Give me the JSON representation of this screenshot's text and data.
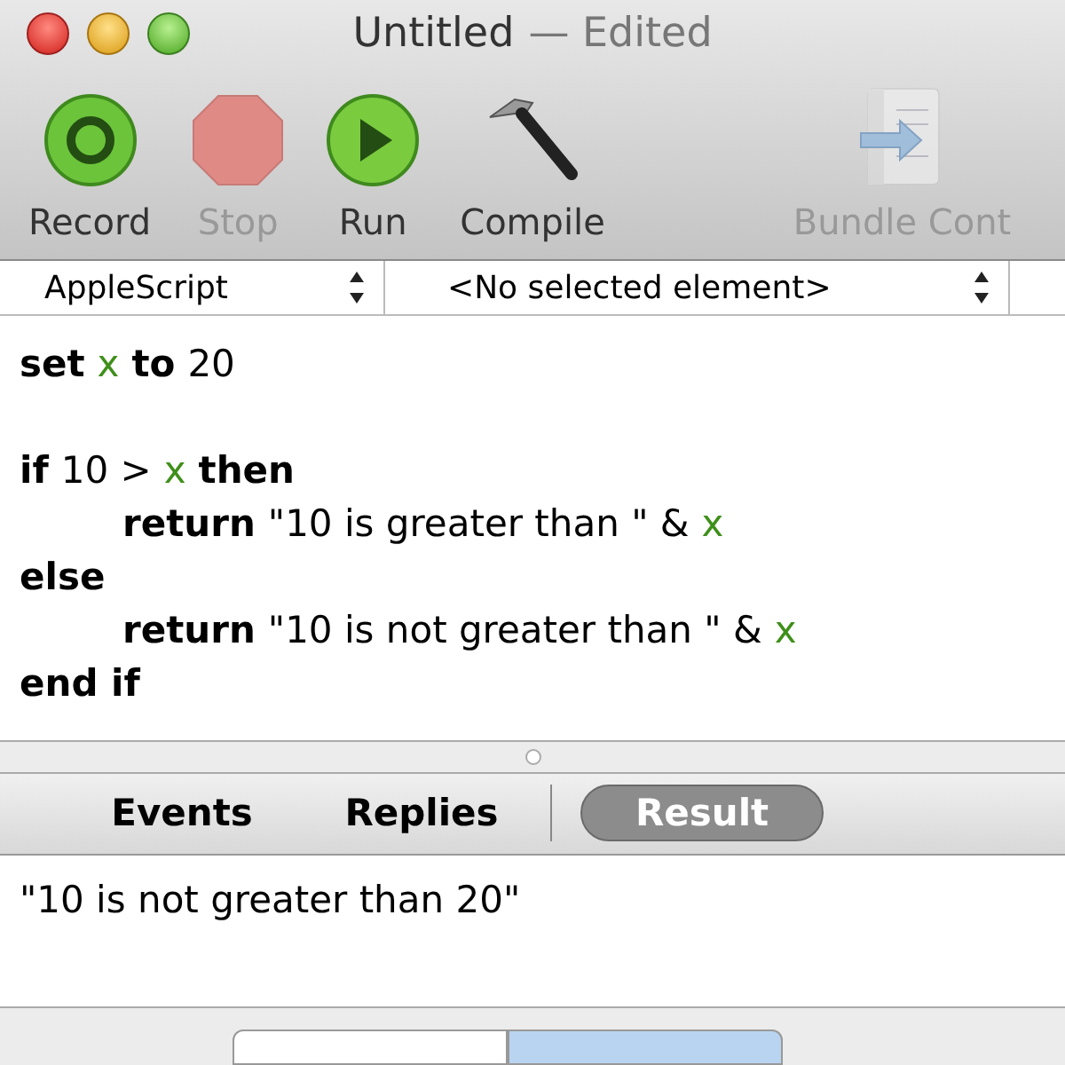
{
  "window": {
    "title": "Untitled",
    "title_suffix": "— Edited"
  },
  "toolbar": [
    {
      "kind": "record",
      "label": "Record",
      "disabled": false
    },
    {
      "kind": "stop",
      "label": "Stop",
      "disabled": true
    },
    {
      "kind": "run",
      "label": "Run",
      "disabled": false
    },
    {
      "kind": "compile",
      "label": "Compile",
      "disabled": false
    },
    {
      "kind": "bundle",
      "label": "Bundle Cont",
      "disabled": true
    }
  ],
  "selectors": [
    {
      "value": "AppleScript"
    },
    {
      "value": "<No selected element>"
    }
  ],
  "code_lines": [
    {
      "kind": "code",
      "tokens": [
        {
          "kind": "keyword",
          "text": "set"
        },
        {
          "kind": "variable",
          "text": "x"
        },
        {
          "kind": "keyword",
          "text": "to"
        },
        {
          "kind": "plain",
          "text": "20"
        }
      ]
    },
    {
      "kind": "blank"
    },
    {
      "kind": "code",
      "tokens": [
        {
          "kind": "keyword",
          "text": "if"
        },
        {
          "kind": "plain",
          "text": "10 >"
        },
        {
          "kind": "variable",
          "text": "x"
        },
        {
          "kind": "keyword",
          "text": "then"
        }
      ],
      "children": [
        {
          "kind": "code",
          "tokens": [
            {
              "kind": "keyword",
              "text": "return"
            },
            {
              "kind": "plain",
              "text": "\"10 is greater than \" &"
            },
            {
              "kind": "variable",
              "text": "x"
            }
          ]
        }
      ]
    },
    {
      "kind": "code",
      "tokens": [
        {
          "kind": "keyword",
          "text": "else"
        }
      ],
      "children": [
        {
          "kind": "code",
          "tokens": [
            {
              "kind": "keyword",
              "text": "return"
            },
            {
              "kind": "plain",
              "text": "\"10 is not greater than \" &"
            },
            {
              "kind": "variable",
              "text": "x"
            }
          ]
        }
      ]
    },
    {
      "kind": "code",
      "tokens": [
        {
          "kind": "keyword",
          "text": "end if"
        }
      ]
    }
  ],
  "log_tabs": [
    {
      "label": "Events",
      "selected": false
    },
    {
      "label": "Replies",
      "selected": false
    },
    {
      "label": "Result",
      "selected": true
    }
  ],
  "result": "\"10 is not greater than 20\"",
  "bottom_tabs": [
    {
      "selected": false
    },
    {
      "selected": true
    }
  ]
}
